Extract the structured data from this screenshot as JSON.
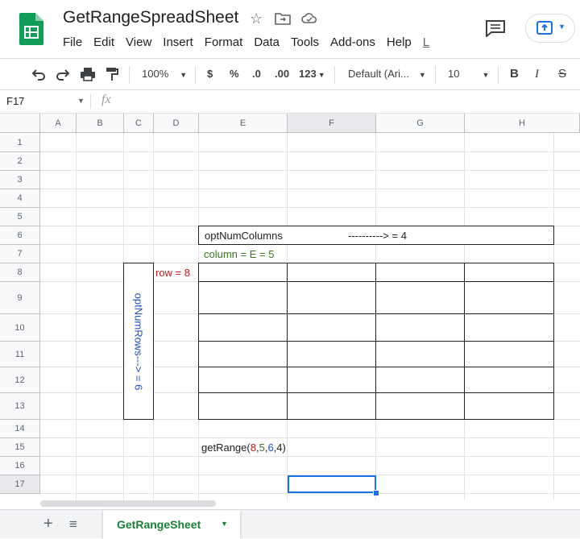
{
  "app": {
    "title": "GetRangeSpreadSheet",
    "menu": [
      "File",
      "Edit",
      "View",
      "Insert",
      "Format",
      "Data",
      "Tools",
      "Add-ons",
      "Help",
      "L"
    ]
  },
  "toolbar": {
    "zoom": "100%",
    "currency": "$",
    "percent": "%",
    "decrease_decimal": ".0",
    "increase_decimal": ".00",
    "number_format": "123",
    "font": "Default (Ari...",
    "font_size": "10",
    "bold": "B",
    "italic": "I",
    "strikethrough": "S"
  },
  "formula_bar": {
    "name_box": "F17",
    "fx": "fx",
    "content": ""
  },
  "grid": {
    "columns": [
      "A",
      "B",
      "C",
      "D",
      "E",
      "F",
      "G",
      "H"
    ],
    "rows": [
      "1",
      "2",
      "3",
      "4",
      "5",
      "6",
      "7",
      "8",
      "9",
      "10",
      "11",
      "12",
      "13",
      "14",
      "15",
      "16",
      "17"
    ],
    "selected_cell": "F17"
  },
  "cells": {
    "opt_num_columns_label": "optNumColumns",
    "opt_num_columns_value": "----------> = 4",
    "column_note": "column = E = 5",
    "row_note": "row = 8",
    "opt_num_rows_note": "optNumRows---> = 6",
    "formula": {
      "prefix": "getRange(",
      "row": "8",
      "sep1": ",",
      "column": "5",
      "sep2": ",",
      "num_rows": "6",
      "sep3": ",",
      "num_columns": "4",
      "suffix": ")"
    }
  },
  "colors": {
    "row_text": "#b71c1c",
    "column_text": "#38761d",
    "rows_count_text": "#1c4fc2",
    "selection": "#1a73e8",
    "sheet_tab": "#188038"
  },
  "sheets": {
    "active": "GetRangeSheet"
  }
}
